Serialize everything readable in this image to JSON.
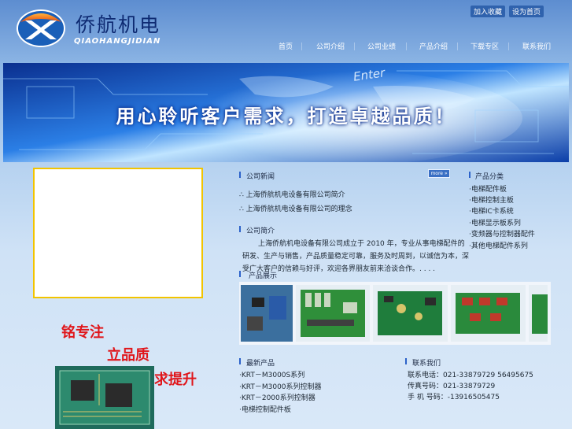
{
  "header": {
    "logo_cn": "侨航机电",
    "logo_en": "QIAOHANGJIDIAN",
    "bookmark_label": "加入收藏",
    "homepage_label": "设为首页"
  },
  "nav": {
    "items": [
      "首页",
      "公司介绍",
      "公司业绩",
      "产品介绍",
      "下载专区",
      "联系我们"
    ]
  },
  "banner": {
    "slogan": "用心聆听客户需求，打造卓越品质！",
    "enter_text": "Enter"
  },
  "left": {
    "slogan_1": "铭专注",
    "slogan_2": "立品质",
    "slogan_3": "求提升"
  },
  "news": {
    "title": "公司新闻",
    "more_label": "more »",
    "items": [
      "∴ 上海侨航机电设备有限公司简介",
      "∴ 上海侨航机电设备有限公司的理念"
    ]
  },
  "about": {
    "title": "公司简介",
    "text": "上海侨航机电设备有限公司成立于 2010 年，专业从事电梯配件的研发、生产与销售，产品质量稳定可靠，服务及时周到，以诚信为本，深受广大客户的信赖与好评，欢迎各界朋友前来洽谈合作。. . . ."
  },
  "products": {
    "title": "产品展示"
  },
  "categories": {
    "title": "产品分类",
    "items": [
      "·电梯配件板",
      "·电梯控制主板",
      "·电梯IC卡系统",
      "·电梯显示板系列",
      "·变频器与控制器配件",
      "·其他电梯配件系列"
    ]
  },
  "latest": {
    "title": "最新产品",
    "items": [
      "·KRT－M3000S系列",
      "·KRT－M3000系列控制器",
      "·KRT－2000系列控制器",
      "·电梯控制配件板"
    ]
  },
  "contact": {
    "title": "联系我们",
    "lines": [
      "联系电话：021-33879729 56495675",
      "传真号码：021-33879729",
      "手 机 号码：-13916505475"
    ]
  },
  "colors": {
    "accent": "#2c62c9",
    "slogan_red": "#e0161b",
    "box_border": "#f2c400"
  }
}
